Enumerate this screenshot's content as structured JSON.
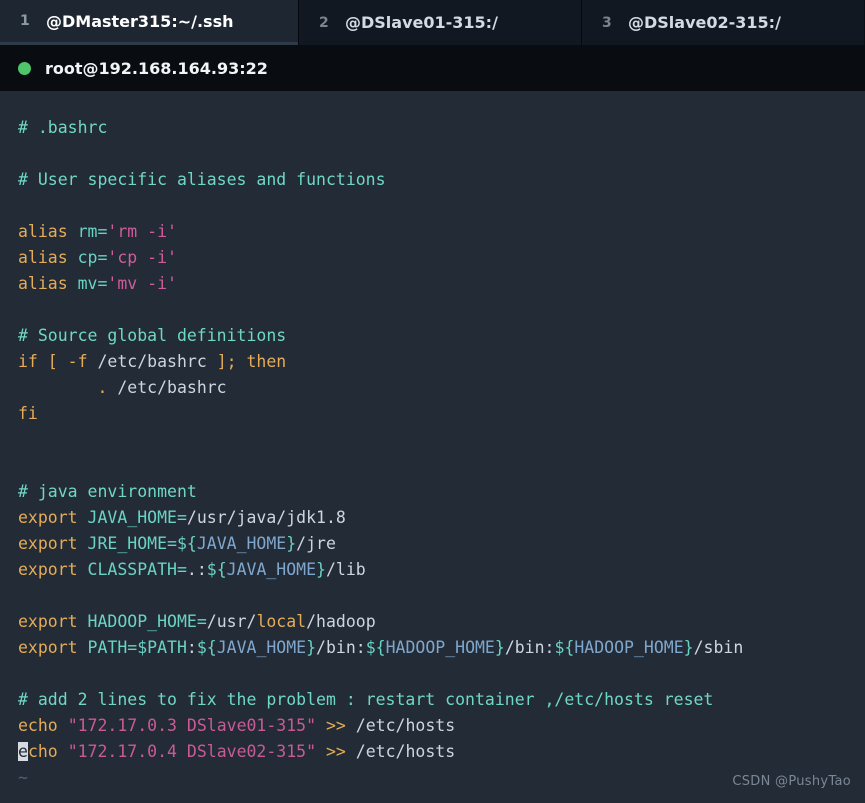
{
  "tabs": [
    {
      "index": "1",
      "title": "@DMaster315:~/.ssh",
      "active": true
    },
    {
      "index": "2",
      "title": "@DSlave01-315:/",
      "active": false
    },
    {
      "index": "3",
      "title": "@DSlave02-315:/",
      "active": false
    }
  ],
  "status": {
    "dot_icon": "connected-dot-icon",
    "dot_color": "#4ec569",
    "text": "root@192.168.164.93:22"
  },
  "editor": {
    "file_hint": ".bashrc",
    "cursor": {
      "line": 20,
      "column": 1,
      "char": "e"
    },
    "colors": {
      "background": "#232b36",
      "comment": "#6fd8c5",
      "keyword": "#e5ac57",
      "variable": "#69d3c4",
      "string": "#cf5c9c",
      "path": "#cdd6e0",
      "expansion": "#7fa7cd",
      "tilde": "#4c6176",
      "cursor_bg": "#d5dbe1"
    },
    "lines": [
      {
        "t": "comment",
        "text": "# .bashrc"
      },
      {
        "t": "blank",
        "text": ""
      },
      {
        "t": "comment",
        "text": "# User specific aliases and functions"
      },
      {
        "t": "blank",
        "text": ""
      },
      {
        "t": "alias",
        "kw": "alias",
        "name": "rm",
        "value": "'rm -i'"
      },
      {
        "t": "alias",
        "kw": "alias",
        "name": "cp",
        "value": "'cp -i'"
      },
      {
        "t": "alias",
        "kw": "alias",
        "name": "mv",
        "value": "'mv -i'"
      },
      {
        "t": "blank",
        "text": ""
      },
      {
        "t": "comment",
        "text": "# Source global definitions"
      },
      {
        "t": "if",
        "text": "if [ -f /etc/bashrc ]; then"
      },
      {
        "t": "source",
        "text": "        . /etc/bashrc"
      },
      {
        "t": "fi",
        "text": "fi"
      },
      {
        "t": "blank",
        "text": ""
      },
      {
        "t": "blank",
        "text": ""
      },
      {
        "t": "comment",
        "text": "# java environment"
      },
      {
        "t": "export",
        "text": "export JAVA_HOME=/usr/java/jdk1.8"
      },
      {
        "t": "export",
        "text": "export JRE_HOME=${JAVA_HOME}/jre"
      },
      {
        "t": "export",
        "text": "export CLASSPATH=.:${JAVA_HOME}/lib"
      },
      {
        "t": "blank",
        "text": ""
      },
      {
        "t": "export",
        "text": "export HADOOP_HOME=/usr/local/hadoop"
      },
      {
        "t": "export",
        "text": "export PATH=$PATH:${JAVA_HOME}/bin:${HADOOP_HOME}/bin:${HADOOP_HOME}/sbin"
      },
      {
        "t": "blank",
        "text": ""
      },
      {
        "t": "comment",
        "text": "# add 2 lines to fix the problem : restart container ,/etc/hosts reset"
      },
      {
        "t": "echo",
        "kw": "echo",
        "arg": "\"172.17.0.3 DSlave01-315\"",
        "op": ">>",
        "target": "/etc/hosts"
      },
      {
        "t": "echo_cur",
        "kw": "echo",
        "arg": "\"172.17.0.4 DSlave02-315\"",
        "op": ">>",
        "target": "/etc/hosts"
      },
      {
        "t": "tilde",
        "text": "~"
      }
    ]
  },
  "watermark": {
    "text": "CSDN @PushyTao"
  }
}
